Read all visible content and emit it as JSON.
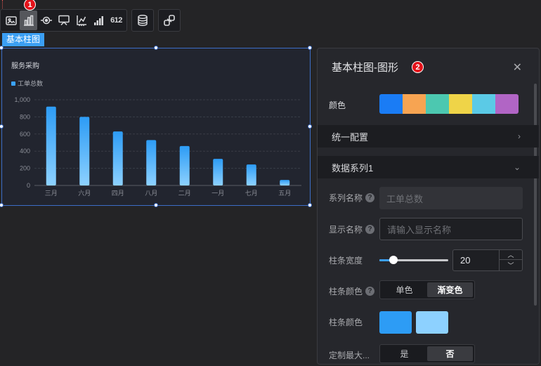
{
  "toolbar": {
    "badge": "1",
    "icons": [
      "image-icon",
      "bar-chart-icon",
      "radar-icon",
      "pie-chart-icon",
      "axis-chart-icon",
      "signal-bars-icon",
      "number-icon",
      "database-icon",
      "link-icon"
    ],
    "number_icon_text": "612"
  },
  "component_label": "基本柱图",
  "chart": {
    "title": "服务采购",
    "legend": "工单总数"
  },
  "chart_data": {
    "type": "bar",
    "title": "服务采购",
    "categories": [
      "三月",
      "六月",
      "四月",
      "八月",
      "二月",
      "一月",
      "七月",
      "五月"
    ],
    "series": [
      {
        "name": "工单总数",
        "values": [
          920,
          800,
          630,
          530,
          460,
          310,
          245,
          65
        ]
      }
    ],
    "y_ticks": [
      "0",
      "200",
      "400",
      "600",
      "800",
      "1,000"
    ],
    "ylim": [
      0,
      1000
    ],
    "grid": true,
    "legend_position": "top-left"
  },
  "panel": {
    "title": "基本柱图-图形",
    "badge": "2",
    "color_label": "颜色",
    "palette": [
      "#1a7cf5",
      "#f7a452",
      "#4cc8b0",
      "#efd448",
      "#5bcae6",
      "#b165c5"
    ],
    "unified_config": "统一配置",
    "data_series": "数据系列1",
    "series_name_label": "系列名称",
    "series_name_value": "工单总数",
    "display_name_label": "显示名称",
    "display_name_placeholder": "请输入显示名称",
    "bar_width_label": "柱条宽度",
    "bar_width_value": "20",
    "bar_width_fraction": 0.2,
    "bar_color_mode_label": "柱条颜色",
    "bar_color_mode_options": [
      "单色",
      "渐变色"
    ],
    "bar_color_mode_selected": "渐变色",
    "bar_color_label": "柱条颜色",
    "bar_color_start": "#2d9cf5",
    "bar_color_end": "#8dd1ff",
    "custom_max_label": "定制最大...",
    "custom_max_options": [
      "是",
      "否"
    ],
    "custom_max_selected": "否"
  }
}
